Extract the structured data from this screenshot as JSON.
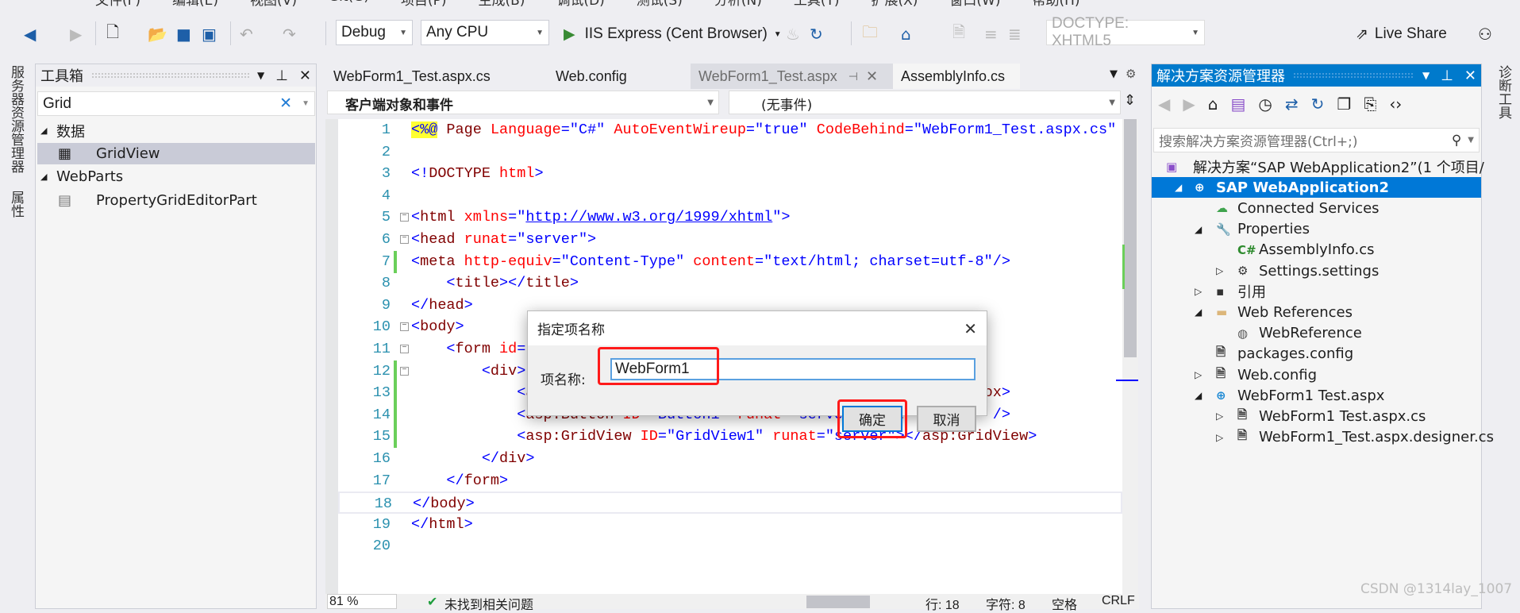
{
  "menu": [
    "文件(F)",
    "编辑(E)",
    "视图(V)",
    "Git(G)",
    "项目(P)",
    "生成(B)",
    "调试(D)",
    "测试(S)",
    "分析(N)",
    "工具(T)",
    "扩展(X)",
    "窗口(W)",
    "帮助(H)"
  ],
  "toolbar": {
    "config": "Debug",
    "platform": "Any CPU",
    "run_target": "IIS Express (Cent Browser)",
    "doctype": "DOCTYPE: XHTML5",
    "live_share": "Live Share"
  },
  "left_strip": {
    "server_explorer": "服务器资源管理器",
    "properties": "属性"
  },
  "right_strip": {
    "diagnostics": "诊断工具"
  },
  "toolbox": {
    "title": "工具箱",
    "search_value": "Grid",
    "groups": [
      {
        "label": "数据",
        "items": [
          "GridView"
        ]
      },
      {
        "label": "WebParts",
        "items": [
          "PropertyGridEditorPart"
        ]
      }
    ]
  },
  "editor": {
    "tabs": [
      "WebForm1_Test.aspx.cs",
      "Web.config",
      "WebForm1_Test.aspx",
      "AssemblyInfo.cs"
    ],
    "objects_dropdown": "客户端对象和事件",
    "events_dropdown": "(无事件)",
    "lines": [
      [
        [
          "<%@",
          "d"
        ],
        [
          " Page ",
          "e"
        ],
        [
          "Language",
          "a"
        ],
        [
          "=\"C#\" ",
          "v"
        ],
        [
          "AutoEventWireup",
          "a"
        ],
        [
          "=\"true\" ",
          "v"
        ],
        [
          "CodeBehind",
          "a"
        ],
        [
          "=\"WebForm1_Test.aspx.cs\"",
          "v"
        ]
      ],
      [],
      [
        [
          "<!",
          "d"
        ],
        [
          "DOCTYPE ",
          "e"
        ],
        [
          "html",
          "a"
        ],
        [
          ">",
          "d"
        ]
      ],
      [],
      [
        [
          "<",
          "d"
        ],
        [
          "html ",
          "e"
        ],
        [
          "xmlns",
          "a"
        ],
        [
          "=\"",
          "v"
        ],
        [
          "http://www.w3.org/1999/xhtml",
          "u"
        ],
        [
          "\">",
          "d"
        ]
      ],
      [
        [
          "<",
          "d"
        ],
        [
          "head ",
          "e"
        ],
        [
          "runat",
          "a"
        ],
        [
          "=\"server\">",
          "v"
        ]
      ],
      [
        [
          "<",
          "d"
        ],
        [
          "meta ",
          "e"
        ],
        [
          "http-equiv",
          "a"
        ],
        [
          "=\"Content-Type\" ",
          "v"
        ],
        [
          "content",
          "a"
        ],
        [
          "=\"text/html; charset=utf-8\"/>",
          "v"
        ]
      ],
      [
        [
          "    <",
          "d"
        ],
        [
          "title",
          "e"
        ],
        [
          "></",
          "d"
        ],
        [
          "title",
          "e"
        ],
        [
          ">",
          "d"
        ]
      ],
      [
        [
          "</",
          "d"
        ],
        [
          "head",
          "e"
        ],
        [
          ">",
          "d"
        ]
      ],
      [
        [
          "<",
          "d"
        ],
        [
          "body",
          "e"
        ],
        [
          ">",
          "d"
        ]
      ],
      [
        [
          "    <",
          "d"
        ],
        [
          "form ",
          "e"
        ],
        [
          "id",
          "a"
        ],
        [
          "=\"form1\" ",
          "v"
        ],
        [
          "runat",
          "a"
        ],
        [
          "=\"server\">",
          "v"
        ]
      ],
      [
        [
          "        <",
          "d"
        ],
        [
          "div",
          "e"
        ],
        [
          ">",
          "d"
        ]
      ],
      [
        [
          "            <",
          "d"
        ],
        [
          "asp:TextBox ",
          "e"
        ],
        [
          "ID",
          "a"
        ],
        [
          "=\"TextBox1\" ",
          "v"
        ],
        [
          "runat",
          "a"
        ],
        [
          "=\"server\"></",
          "v"
        ],
        [
          "asp:TextBox",
          "e"
        ],
        [
          ">",
          "d"
        ]
      ],
      [
        [
          "            <",
          "d"
        ],
        [
          "asp:Button ",
          "e"
        ],
        [
          "ID",
          "a"
        ],
        [
          "=\"Button1\" ",
          "v"
        ],
        [
          "runat",
          "a"
        ],
        [
          "=\"server\" ",
          "v"
        ],
        [
          "Text",
          "a"
        ],
        [
          "=\"Button\" />",
          "v"
        ]
      ],
      [
        [
          "            <",
          "d"
        ],
        [
          "asp:GridView ",
          "e"
        ],
        [
          "ID",
          "a"
        ],
        [
          "=\"GridView1\" ",
          "v"
        ],
        [
          "runat",
          "a"
        ],
        [
          "=\"server\"></",
          "v"
        ],
        [
          "asp:GridView",
          "e"
        ],
        [
          ">",
          "d"
        ]
      ],
      [
        [
          "        </",
          "d"
        ],
        [
          "div",
          "e"
        ],
        [
          ">",
          "d"
        ]
      ],
      [
        [
          "    </",
          "d"
        ],
        [
          "form",
          "e"
        ],
        [
          ">",
          "d"
        ]
      ],
      [
        [
          "</",
          "d"
        ],
        [
          "body",
          "e"
        ],
        [
          ">",
          "d"
        ]
      ],
      [
        [
          "</",
          "d"
        ],
        [
          "html",
          "e"
        ],
        [
          ">",
          "d"
        ]
      ],
      []
    ]
  },
  "status": {
    "zoom": "81 %",
    "issues": "未找到相关问题",
    "line": "行: 18",
    "char": "字符: 8",
    "indent": "空格",
    "eol": "CRLF"
  },
  "solution_explorer": {
    "title": "解决方案资源管理器",
    "search_placeholder": "搜索解决方案资源管理器(Ctrl+;)",
    "items": [
      {
        "label": "解决方案“SAP  WebApplication2”(1 个项目/",
        "level": 0,
        "arrow": "",
        "icon": "solution-icon"
      },
      {
        "label": "SAP  WebApplication2",
        "level": 1,
        "arrow": "◢",
        "icon": "web-project-icon",
        "selected": true
      },
      {
        "label": "Connected Services",
        "level": 2,
        "arrow": "",
        "icon": "connected-services-icon"
      },
      {
        "label": "Properties",
        "level": 2,
        "arrow": "◢",
        "icon": "wrench-icon"
      },
      {
        "label": "AssemblyInfo.cs",
        "level": 3,
        "arrow": "",
        "icon": "csharp-file-icon"
      },
      {
        "label": "Settings.settings",
        "level": 3,
        "arrow": "▷",
        "icon": "gear-icon"
      },
      {
        "label": "引用",
        "level": 2,
        "arrow": "▷",
        "icon": "references-icon"
      },
      {
        "label": "Web References",
        "level": 2,
        "arrow": "◢",
        "icon": "folder-icon"
      },
      {
        "label": "WebReference",
        "level": 3,
        "arrow": "",
        "icon": "web-reference-icon"
      },
      {
        "label": "packages.config",
        "level": 2,
        "arrow": "",
        "icon": "config-file-icon"
      },
      {
        "label": "Web.config",
        "level": 2,
        "arrow": "▷",
        "icon": "config-file-icon"
      },
      {
        "label": "WebForm1  Test.aspx",
        "level": 2,
        "arrow": "◢",
        "icon": "aspx-file-icon"
      },
      {
        "label": "WebForm1  Test.aspx.cs",
        "level": 3,
        "arrow": "▷",
        "icon": "cs-code-file-icon"
      },
      {
        "label": "WebForm1_Test.aspx.designer.cs",
        "level": 3,
        "arrow": "▷",
        "icon": "cs-code-file-icon"
      }
    ]
  },
  "dialog": {
    "title": "指定项名称",
    "field_label": "项名称:",
    "field_value": "WebForm1",
    "ok": "确定",
    "cancel": "取消"
  },
  "watermark": "CSDN @1314lay_1007",
  "colors": {
    "accent": "#007acc",
    "highlight": "#ff1a1a",
    "selection": "#0078d7"
  }
}
